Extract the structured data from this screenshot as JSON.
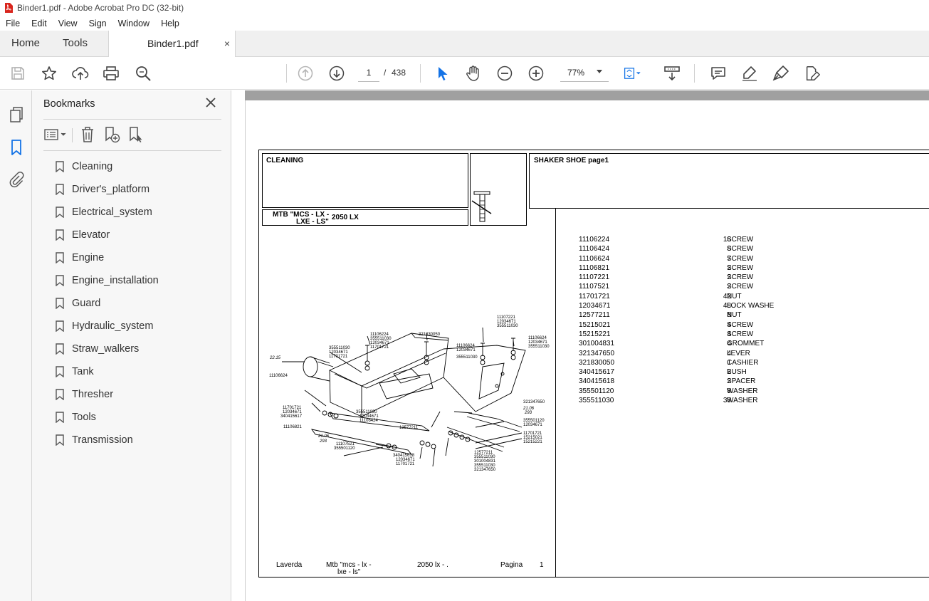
{
  "window": {
    "title": "Binder1.pdf - Adobe Acrobat Pro DC (32-bit)"
  },
  "menu": {
    "items": [
      "File",
      "Edit",
      "View",
      "Sign",
      "Window",
      "Help"
    ]
  },
  "tabs": {
    "home": "Home",
    "tools": "Tools",
    "document": "Binder1.pdf",
    "close": "×"
  },
  "toolbar": {
    "icons": [
      "save-icon",
      "star-icon",
      "upload-icon",
      "print-icon",
      "search-zoom-icon",
      "page-up-icon",
      "page-down-icon",
      "select-cursor-icon",
      "hand-icon",
      "zoom-out-icon",
      "zoom-in-icon",
      "fit-page-icon",
      "scroll-mode-icon",
      "comment-icon",
      "highlight-icon",
      "sign-icon",
      "edit-icon"
    ],
    "current_page": "1",
    "page_separator": "/",
    "total_pages": "438",
    "zoom": "77%"
  },
  "bookmarks": {
    "title": "Bookmarks",
    "close": "×",
    "items": [
      "Cleaning",
      "Driver's_platform",
      "Electrical_system",
      "Elevator",
      "Engine",
      "Engine_installation",
      "Guard",
      "Hydraulic_system",
      "Straw_walkers",
      "Tank",
      "Thresher",
      "Tools",
      "Transmission"
    ]
  },
  "document": {
    "section": "CLEANING",
    "model_line1": "MTB \"MCS - LX -",
    "model_line2": "LXE - LS\"",
    "model_code": "2050 LX",
    "group_title": "SHAKER SHOE  page1",
    "parts": [
      {
        "pn": "11106224",
        "qty": "16",
        "desc": "SCREW"
      },
      {
        "pn": "11106424",
        "qty": "8",
        "desc": "SCREW"
      },
      {
        "pn": "11106624",
        "qty": "7",
        "desc": "SCREW"
      },
      {
        "pn": "11106821",
        "qty": "2",
        "desc": "SCREW"
      },
      {
        "pn": "11107221",
        "qty": "2",
        "desc": "SCREW"
      },
      {
        "pn": "11107521",
        "qty": "2",
        "desc": "SCREW"
      },
      {
        "pn": "11701721",
        "qty": "42",
        "desc": "NUT"
      },
      {
        "pn": "12034671",
        "qty": "48",
        "desc": "LOCK WASHE"
      },
      {
        "pn": "12577211",
        "qty": "8",
        "desc": "NUT"
      },
      {
        "pn": "15215021",
        "qty": "4",
        "desc": "SCREW"
      },
      {
        "pn": "15215221",
        "qty": "4",
        "desc": "SCREW"
      },
      {
        "pn": "301004831",
        "qty": "4",
        "desc": "GROMMET"
      },
      {
        "pn": "321347650",
        "qty": "4",
        "desc": "LEVER"
      },
      {
        "pn": "321830050",
        "qty": "1",
        "desc": "CASHIER"
      },
      {
        "pn": "340415617",
        "qty": "2",
        "desc": "BUSH"
      },
      {
        "pn": "340415618",
        "qty": "2",
        "desc": "SPACER"
      },
      {
        "pn": "355501120",
        "qty": "8",
        "desc": "WASHER"
      },
      {
        "pn": "355511030",
        "qty": "38",
        "desc": "WASHER"
      }
    ],
    "diagram_labels": {
      "l1": "11106224",
      "l2": "355511030",
      "l3": "12034671",
      "l4": "11701721",
      "l5": "321830050",
      "l6": "11107221",
      "l7": "12034671",
      "l8": "355511030",
      "l9": "11106624",
      "l10": "12034671",
      "l11": "355511030",
      "l12": "11106624",
      "l13": "12034671",
      "l14": "355511030",
      "l15": "355511030",
      "l16": "12034671",
      "l17": "11701721",
      "l18": "22.15",
      "l19": "11106624",
      "l20": "11701721",
      "l21": "12034671",
      "l22": "340415617",
      "l23": "355511030",
      "l24": "12034671",
      "l25": "11106424",
      "l26": "11106821",
      "l27": "12577211",
      "l28": "21.06",
      "l29": "293",
      "l30": "11107521",
      "l31": "355501120",
      "l32": "321347650",
      "l33": "21.06",
      "l34": "293",
      "l35": "355501120",
      "l36": "12034671",
      "l37": "11701721",
      "l38": "15215021",
      "l39": "15215221",
      "l40": "12577211",
      "l41": "355511030",
      "l42": "301004831",
      "l43": "355511030",
      "l44": "321347650",
      "l45": "340415618",
      "l46": "12034671",
      "l47": "11701721"
    },
    "footer": {
      "brand": "Laverda",
      "model_line1": "Mtb \"mcs - lx -",
      "model_line2": "lxe - ls\"",
      "code": "2050 lx - .",
      "page_label": "Pagina",
      "page_num": "1"
    }
  }
}
